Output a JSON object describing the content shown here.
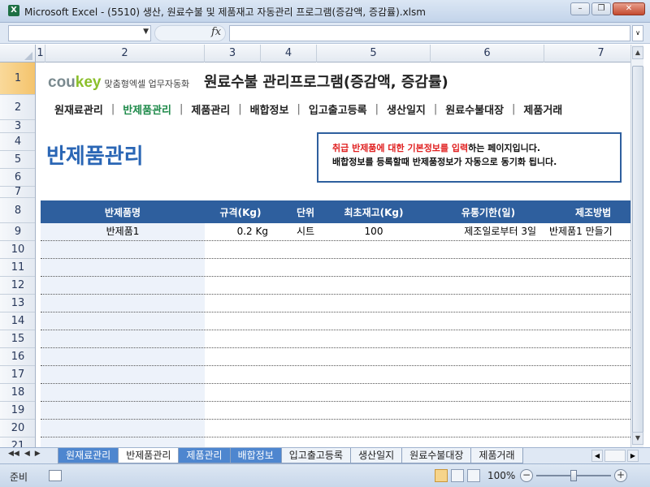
{
  "window": {
    "title": "Microsoft Excel - (5510) 생산, 원료수불 및 제품재고 자동관리 프로그램(증감액, 증감률).xlsm",
    "app_icon": "excel-icon",
    "controls": [
      "minimize",
      "restore",
      "close"
    ]
  },
  "formula_bar": {
    "name_box": "",
    "fx_label": "fx",
    "formula": ""
  },
  "columns": [
    "1",
    "2",
    "3",
    "4",
    "5",
    "6",
    "7"
  ],
  "rows": [
    "1",
    "2",
    "3",
    "4",
    "5",
    "6",
    "7",
    "8",
    "9",
    "10",
    "11",
    "12",
    "13",
    "14",
    "15",
    "16",
    "17",
    "18",
    "19",
    "20",
    "21"
  ],
  "selected_row": "1",
  "logo": {
    "brand_a": "cou",
    "brand_b": "key",
    "subtitle": "맞춤형엑셀 업무자동화"
  },
  "program_title": "원료수불 관리프로그램(증감액, 증감률)",
  "nav_menu": {
    "items": [
      {
        "label": "원재료관리",
        "active": false
      },
      {
        "label": "반제품관리",
        "active": true
      },
      {
        "label": "제품관리",
        "active": false
      },
      {
        "label": "배합정보",
        "active": false
      },
      {
        "label": "입고출고등록",
        "active": false
      },
      {
        "label": "생산일지",
        "active": false
      },
      {
        "label": "원료수불대장",
        "active": false
      },
      {
        "label": "제품거래",
        "active": false
      }
    ],
    "separator": "|"
  },
  "page_heading": "반제품관리",
  "info_box": {
    "line1_highlight": "취급 반제품에 대한 기본정보를 입력",
    "line1_rest": "하는 페이지입니다.",
    "line2": "배합정보를 등록할때 반제품정보가 자동으로 동기화 됩니다."
  },
  "table": {
    "headers": [
      "반제품명",
      "규격(Kg)",
      "단위",
      "최초재고(Kg)",
      "유통기한(일)",
      "제조방법"
    ],
    "rows": [
      [
        "반제품1",
        "0.2 Kg",
        "시트",
        "100",
        "제조일로부터 3일",
        "반제품1 만들기"
      ]
    ]
  },
  "sheet_tabs": [
    {
      "label": "원재료관리",
      "style": "blue"
    },
    {
      "label": "반제품관리",
      "style": "active"
    },
    {
      "label": "제품관리",
      "style": "blue"
    },
    {
      "label": "배합정보",
      "style": "blue"
    },
    {
      "label": "입고출고등록",
      "style": "plain"
    },
    {
      "label": "생산일지",
      "style": "plain"
    },
    {
      "label": "원료수불대장",
      "style": "plain"
    },
    {
      "label": "제품거래",
      "style": "plain"
    }
  ],
  "status": {
    "mode": "준비",
    "zoom": "100%",
    "zoom_minus": "−",
    "zoom_plus": "+"
  },
  "colors": {
    "accent_blue": "#2e5f9e",
    "heading_blue": "#2a66b5",
    "active_nav_green": "#1e8a4a",
    "highlight_red": "#e02020",
    "logo_green": "#8bbf2b"
  }
}
